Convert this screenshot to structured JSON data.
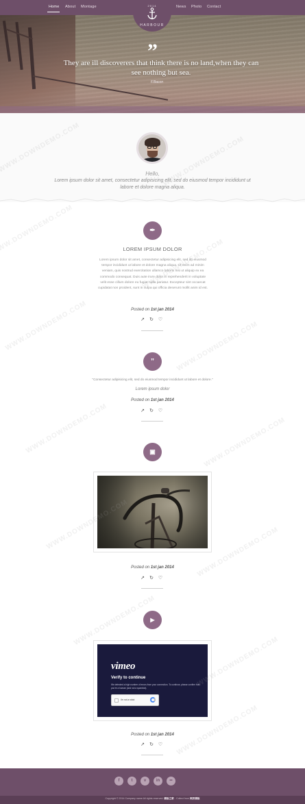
{
  "nav": {
    "left": [
      "Home",
      "About",
      "Montage"
    ],
    "right": [
      "News",
      "Photo",
      "Contact"
    ]
  },
  "logo": {
    "year": "2014",
    "brand": "HARBOUR"
  },
  "hero": {
    "quote_mark": "”",
    "quote": "They are ill discoverers that think there is no land,when they can see nothing but sea.",
    "signature": "F.Bacon"
  },
  "about": {
    "hello": "Hello,",
    "text": "Lorem ipsum dolor sit amet, consectetur adipisicing elit, sed do eiusmod tempor incididunt ut labore et dolore magna aliqua."
  },
  "posts": [
    {
      "icon": "pen-icon",
      "icon_glyph": "✒",
      "title": "LOREM IPSUM DOLOR",
      "body": "Lorem ipsum dolor sit amet, consectetur adipisicing elit, sed do eiusmod tempor incididunt ut labore et dolore magna aliqua. Ut enim ad minim veniam, quis nostrud exercitation ullamco laboris nisi ut aliquip ex ea commodo consequat. Duis aute irure dolor in reprehenderit in voluptate velit esse cillum dolore eu fugiat nulla pariatur. Excepteur sint occaecat cupidatat non proident, sunt in culpa qui officia deserunt mollit anim id est.",
      "posted_label": "Posted on",
      "date": "1st jan 2014"
    },
    {
      "icon": "quote-icon",
      "icon_glyph": "”",
      "quote": "\"Consectetur adipisicing elit, sed do eiusmod tempor incididunt ut labore et dolore.\"",
      "author": "Lorem ipsum dolor",
      "posted_label": "Posted on",
      "date": "1st jan 2014"
    },
    {
      "icon": "image-icon",
      "icon_glyph": "▣",
      "posted_label": "Posted on",
      "date": "1st jan 2014"
    },
    {
      "icon": "video-icon",
      "icon_glyph": "▶",
      "posted_label": "Posted on",
      "date": "1st jan 2014",
      "video": {
        "brand": "vimeo",
        "heading": "Verify to continue",
        "note": "We detected a high number of errors from your connection. To continue, please confirm that you're a human (and not a spambot).",
        "captcha_label": "I'm not a robot"
      }
    }
  ],
  "actions": [
    "share-icon",
    "retweet-icon",
    "heart-icon"
  ],
  "social": [
    "f",
    "t",
    "v",
    "in",
    "••"
  ],
  "footer": {
    "text_prefix": "Copyright © 2014 Company name All rights reserved.",
    "link1": "模板之家",
    "text_middle": " - Collect from ",
    "link2": "网页模板"
  },
  "watermark": "WWW.DOWNDEMO.COM",
  "colors": {
    "brand": "#6e4f69",
    "accent": "#8e6a87"
  }
}
